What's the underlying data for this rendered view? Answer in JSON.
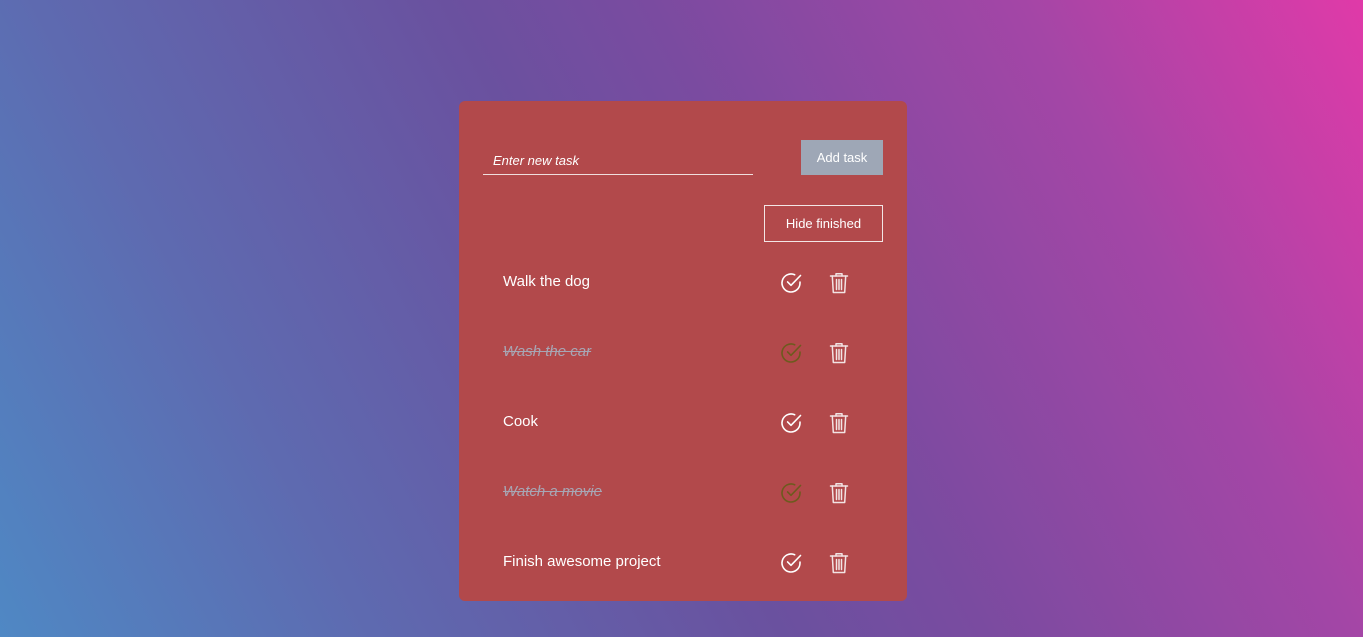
{
  "new_task": {
    "placeholder": "Enter new task",
    "value": ""
  },
  "add_button_label": "Add task",
  "hide_button_label": "Hide finished",
  "colors": {
    "card_background": "#b2494b",
    "done_check": "#6e5a1e",
    "open_check": "#ffffff",
    "trash": "#f2e4e4",
    "done_text": "#a7a6b4"
  },
  "tasks": [
    {
      "text": "Walk the dog",
      "done": false,
      "check_icon": "check-circle-icon",
      "delete_icon": "trash-icon"
    },
    {
      "text": "Wash the car",
      "done": true,
      "check_icon": "check-circle-icon",
      "delete_icon": "trash-icon"
    },
    {
      "text": "Cook",
      "done": false,
      "check_icon": "check-circle-icon",
      "delete_icon": "trash-icon"
    },
    {
      "text": "Watch a movie",
      "done": true,
      "check_icon": "check-circle-icon",
      "delete_icon": "trash-icon"
    },
    {
      "text": "Finish awesome project",
      "done": false,
      "check_icon": "check-circle-icon",
      "delete_icon": "trash-icon"
    }
  ]
}
